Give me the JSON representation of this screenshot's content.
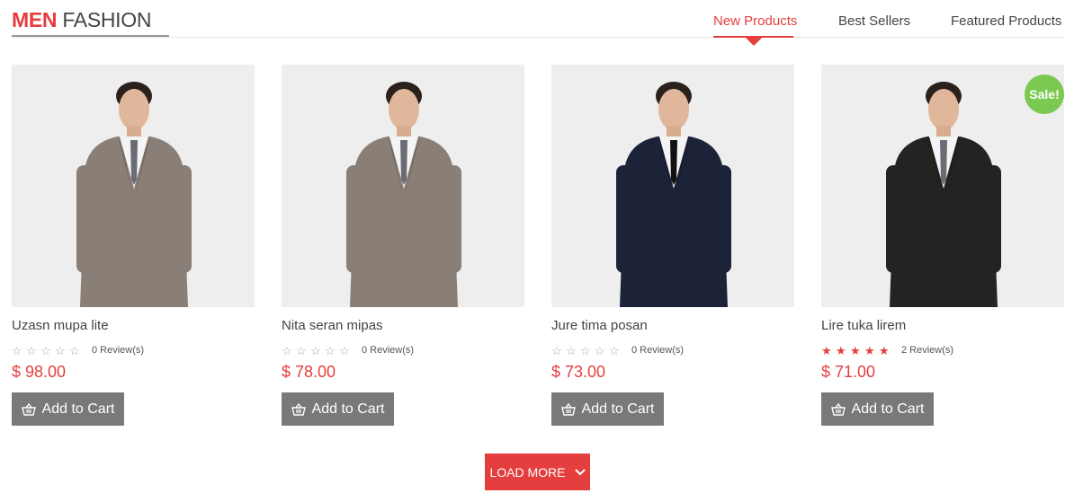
{
  "header": {
    "title_accent": "MEN",
    "title_rest": "FASHION",
    "tabs": [
      {
        "label": "New Products",
        "active": true
      },
      {
        "label": "Best Sellers",
        "active": false
      },
      {
        "label": "Featured Products",
        "active": false
      }
    ]
  },
  "colors": {
    "accent": "#e53e3e",
    "sale_badge": "#7bc950",
    "button_gray": "#797979"
  },
  "products": [
    {
      "name": "Uzasn mupa lite",
      "rating": 0,
      "reviews": "0 Review(s)",
      "price": "$ 98.00",
      "cart_label": "Add to Cart",
      "suit_color": "#8a7f76",
      "sale": ""
    },
    {
      "name": "Nita seran mipas",
      "rating": 0,
      "reviews": "0 Review(s)",
      "price": "$ 78.00",
      "cart_label": "Add to Cart",
      "suit_color": "#8a7f76",
      "sale": ""
    },
    {
      "name": "Jure tima posan",
      "rating": 0,
      "reviews": "0 Review(s)",
      "price": "$ 73.00",
      "cart_label": "Add to Cart",
      "suit_color": "#1c2238",
      "sale": ""
    },
    {
      "name": "Lire tuka lirem",
      "rating": 5,
      "reviews": "2 Review(s)",
      "price": "$ 71.00",
      "cart_label": "Add to Cart",
      "suit_color": "#232323",
      "sale": "Sale!"
    }
  ],
  "load_more_label": "LOAD MORE"
}
